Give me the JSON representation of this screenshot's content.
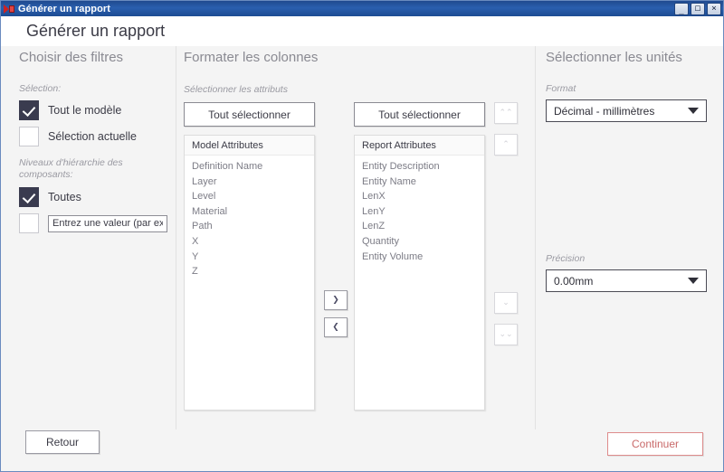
{
  "window": {
    "title": "Générer un rapport",
    "icon": "app-icon",
    "controls": {
      "minimize": "_",
      "maximize": "□",
      "close": "✕"
    }
  },
  "page": {
    "title": "Générer un rapport"
  },
  "filters": {
    "panel_title": "Choisir des filtres",
    "selection_label": "Sélection:",
    "options": [
      {
        "label": "Tout le modèle",
        "checked": true
      },
      {
        "label": "Sélection actuelle",
        "checked": false
      }
    ],
    "hierarchy_label": "Niveaux d'hiérarchie des composants:",
    "hierarchy_options": [
      {
        "label": "Toutes",
        "checked": true
      }
    ],
    "value_input": {
      "value": "",
      "placeholder": "Entrez une valeur (par exemple"
    }
  },
  "columns": {
    "panel_title": "Formater les colonnes",
    "attributes_label": "Sélectionner les attributs",
    "model": {
      "select_all_label": "Tout sélectionner",
      "header": "Model Attributes",
      "items": [
        "Definition Name",
        "Layer",
        "Level",
        "Material",
        "Path",
        "X",
        "Y",
        "Z"
      ]
    },
    "report": {
      "select_all_label": "Tout sélectionner",
      "header": "Report Attributes",
      "items": [
        "Entity Description",
        "Entity Name",
        "LenX",
        "LenY",
        "LenZ",
        "Quantity",
        "Entity Volume"
      ]
    },
    "transfer": {
      "add": "❯",
      "remove": "❮"
    },
    "reorder": {
      "move_top": "⌃⌃",
      "move_up": "⌃",
      "move_down": "⌄",
      "move_bottom": "⌄⌄"
    }
  },
  "units": {
    "panel_title": "Sélectionner les unités",
    "format_label": "Format",
    "format_value": "Décimal - millimètres",
    "precision_label": "Précision",
    "precision_value": "0.00mm"
  },
  "footer": {
    "back_label": "Retour",
    "continue_label": "Continuer"
  },
  "colors": {
    "titlebar": "#2a5fae",
    "checkbox_checked": "#3a3b4f",
    "continue_border": "#de8c8c",
    "continue_text": "#c96a6a",
    "panel_background": "#f4f4f4"
  }
}
